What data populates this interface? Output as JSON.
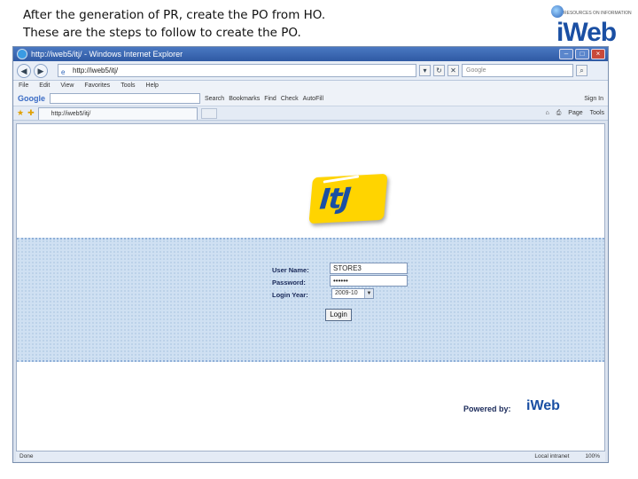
{
  "slide": {
    "caption_line1": "After the generation of PR, create the PO from HO.",
    "caption_line2": "These are the steps to follow to create the PO.",
    "logo_word": "iWeb",
    "logo_tag": "RESOURCES ON INFORMATION"
  },
  "browser": {
    "title": "http://iweb5/itj/ - Windows Internet Explorer",
    "url": "http://iweb5/itj/",
    "search_placeholder": "Google",
    "menu": [
      "File",
      "Edit",
      "View",
      "Favorites",
      "Tools",
      "Help"
    ],
    "google_toolbar": {
      "brand": "Google",
      "items": [
        "Search",
        "Bookmarks",
        "Find",
        "Check",
        "AutoFill",
        "Sign In"
      ]
    },
    "tab_label": "http://iweb5/itj/",
    "tab_tools": [
      "Page",
      "Tools"
    ],
    "status_left": "Done",
    "status_zone": "Local intranet",
    "zoom": "100%"
  },
  "login": {
    "username_label": "User Name:",
    "password_label": "Password:",
    "year_label": "Login Year:",
    "username_value": "STORE3",
    "password_value": "••••••",
    "year_value": "2009-10",
    "button_label": "Login"
  },
  "footer": {
    "powered_by": "Powered by:",
    "powered_logo": "iWeb"
  },
  "brand": {
    "itj_logo_text": "ItJ",
    "accent": "#1a4fa3",
    "yellow": "#ffd400"
  }
}
